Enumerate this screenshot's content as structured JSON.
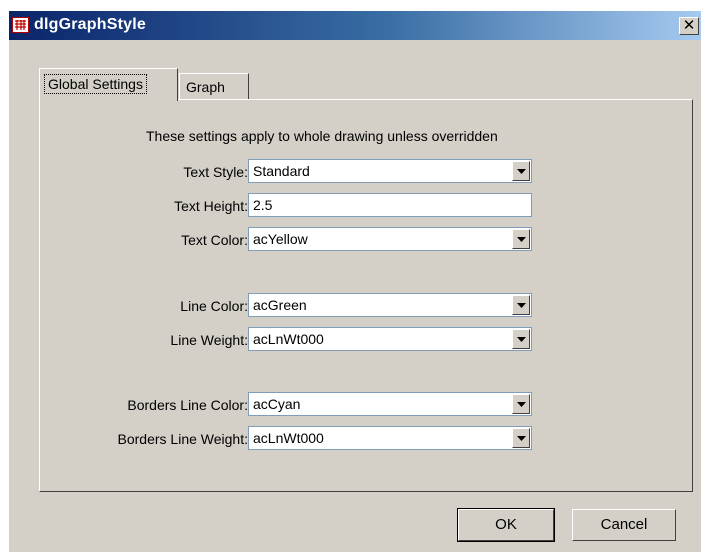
{
  "window": {
    "title": "dlgGraphStyle",
    "close_glyph": "✕"
  },
  "tabs": [
    {
      "label": "Global Settings",
      "selected": true
    },
    {
      "label": "Graph",
      "selected": false
    }
  ],
  "panel": {
    "description": "These settings apply to whole drawing unless overridden",
    "fields": {
      "text_style": {
        "label": "Text Style:",
        "value": "Standard",
        "type": "dropdown"
      },
      "text_height": {
        "label": "Text Height:",
        "value": "2.5",
        "type": "text"
      },
      "text_color": {
        "label": "Text Color:",
        "value": "acYellow",
        "type": "dropdown"
      },
      "line_color": {
        "label": "Line Color:",
        "value": "acGreen",
        "type": "dropdown"
      },
      "line_weight": {
        "label": "Line Weight:",
        "value": "acLnWt000",
        "type": "dropdown"
      },
      "borders_line_color": {
        "label": "Borders Line Color:",
        "value": "acCyan",
        "type": "dropdown"
      },
      "borders_line_weight": {
        "label": "Borders Line Weight:",
        "value": "acLnWt000",
        "type": "dropdown"
      }
    }
  },
  "buttons": {
    "ok": "OK",
    "cancel": "Cancel"
  },
  "icons": {
    "app": "app-icon",
    "close": "close-icon",
    "dropdown": "chevron-down-icon"
  },
  "colors": {
    "title_gradient_start": "#0a246a",
    "title_gradient_end": "#a6caf0",
    "dialog_face": "#d4d0c8"
  }
}
